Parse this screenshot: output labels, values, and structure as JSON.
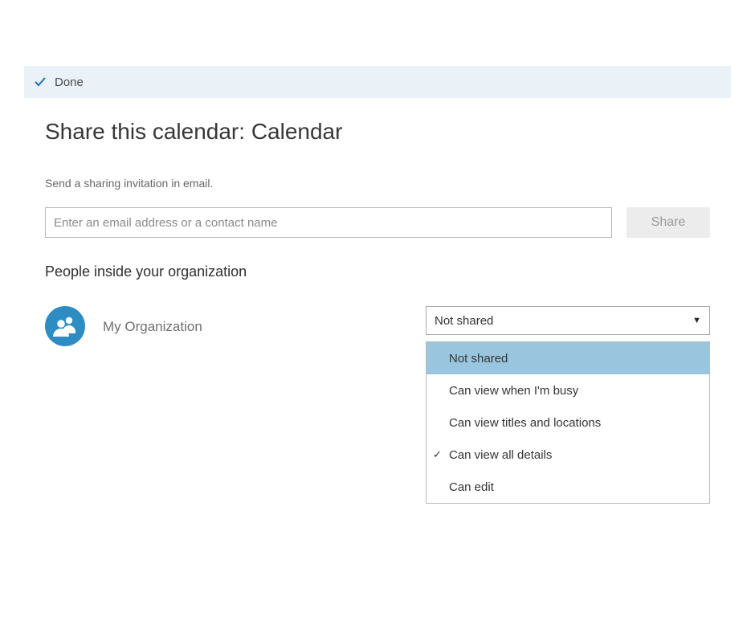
{
  "toolbar": {
    "done_label": "Done"
  },
  "page": {
    "title": "Share this calendar: Calendar",
    "subtitle": "Send a sharing invitation in email.",
    "email_placeholder": "Enter an email address or a contact name",
    "share_button_label": "Share"
  },
  "org_section": {
    "title": "People inside your organization",
    "entity_name": "My Organization",
    "dropdown": {
      "selected_label": "Not shared",
      "highlighted_index": 0,
      "checked_index": 3,
      "options": [
        "Not shared",
        "Can view when I'm busy",
        "Can view titles and locations",
        "Can view all details",
        "Can edit"
      ]
    }
  }
}
